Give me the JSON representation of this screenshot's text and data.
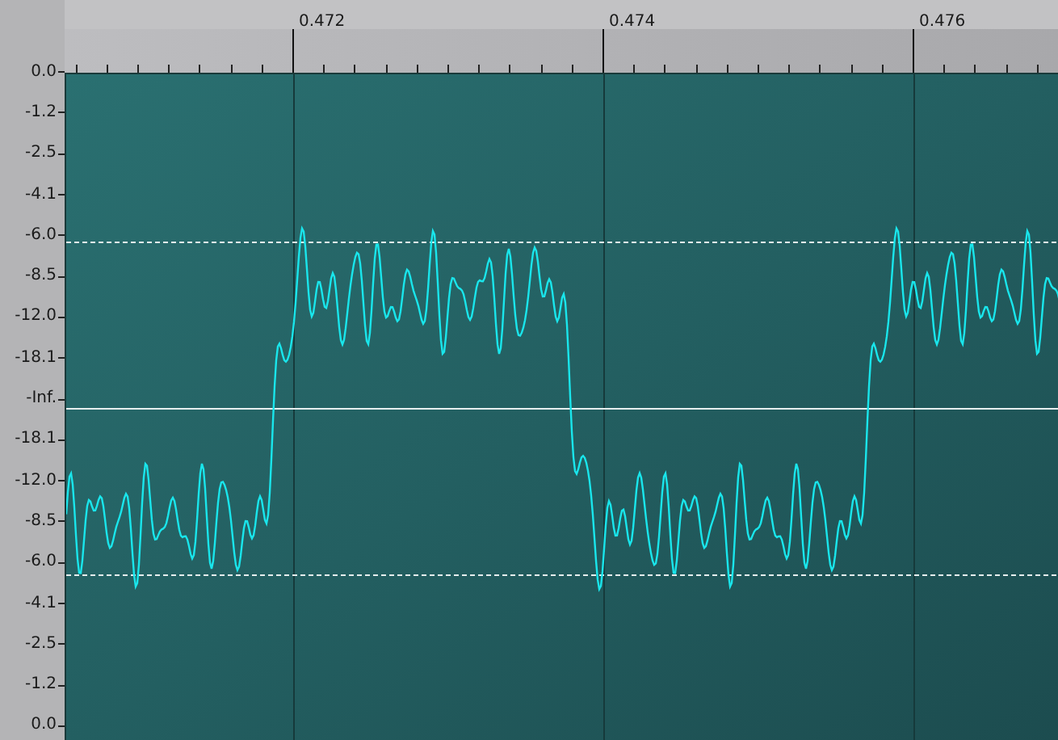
{
  "ruler": {
    "labels": [
      "0.472",
      "0.474",
      "0.476"
    ]
  },
  "level_axis": {
    "labels": [
      "0.0",
      "-1.2",
      "-2.5",
      "-4.1",
      "-6.0",
      "-8.5",
      "-12.0",
      "-18.1",
      "-Inf.",
      "-18.1",
      "-12.0",
      "-8.5",
      "-6.0",
      "-4.1",
      "-2.5",
      "-1.2",
      "0.0"
    ]
  }
}
